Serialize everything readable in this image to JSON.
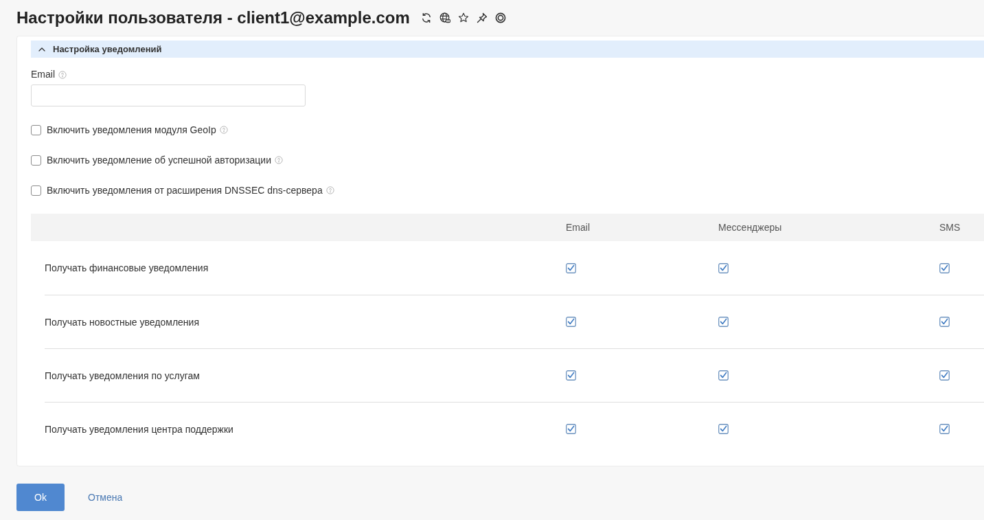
{
  "page": {
    "title": "Настройки пользователя - client1@example.com"
  },
  "section": {
    "title": "Настройка уведомлений",
    "expanded": true
  },
  "email_field": {
    "label": "Email"
  },
  "options": [
    {
      "label": "Включить уведомления модуля GeoIp",
      "checked": false
    },
    {
      "label": "Включить уведомление об успешной авторизации",
      "checked": false
    },
    {
      "label": "Включить уведомления от расширения DNSSEC dns-сервера",
      "checked": false
    }
  ],
  "table": {
    "columns": [
      "Email",
      "Мессенджеры",
      "SMS"
    ],
    "rows": [
      {
        "label": "Получать финансовые уведомления",
        "cells": [
          {
            "checked": true
          },
          {
            "checked": true
          },
          {
            "checked": true
          }
        ]
      },
      {
        "label": "Получать новостные уведомления",
        "cells": [
          {
            "checked": true
          },
          {
            "checked": true
          },
          {
            "checked": true
          }
        ]
      },
      {
        "label": "Получать уведомления по услугам",
        "cells": [
          {
            "checked": true
          },
          {
            "checked": true
          },
          {
            "checked": true
          }
        ]
      },
      {
        "label": "Получать уведомления центра поддержки",
        "cells": [
          {
            "checked": true
          },
          {
            "checked": true
          },
          {
            "checked": true
          }
        ]
      }
    ]
  },
  "buttons": [
    {
      "label": "Ok",
      "kind": "primary"
    },
    {
      "label": "Отмена",
      "kind": "link"
    }
  ]
}
